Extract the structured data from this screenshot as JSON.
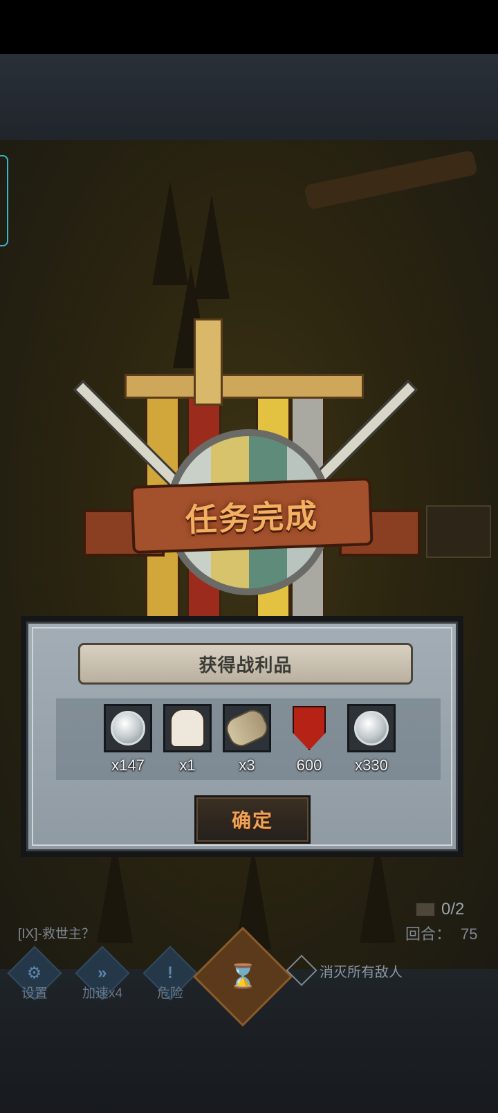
{
  "mission": {
    "title": "任务完成"
  },
  "loot": {
    "title": "获得战利品",
    "items": [
      {
        "icon": "silver-coin-icon",
        "qty": "x147"
      },
      {
        "icon": "horse-icon",
        "qty": "x1"
      },
      {
        "icon": "scroll-icon",
        "qty": "x3"
      },
      {
        "icon": "crest-icon",
        "qty": "600"
      },
      {
        "icon": "silver-coin-icon",
        "qty": "x330"
      }
    ],
    "confirm_label": "确定"
  },
  "status": {
    "chest_counter": "0/2",
    "level_name": "[IX]-救世主？",
    "round_label": "回合：",
    "round_value": "75"
  },
  "toolbar": {
    "settings_label": "设置",
    "speed_label": "加速x4",
    "danger_label": "危险",
    "objective": "消灭所有敌人"
  },
  "colors": {
    "mission_title": "#f4b062",
    "confirm_label": "#f0a255",
    "ribbon": "#a3502c",
    "side_tab": "#39b7c9"
  }
}
